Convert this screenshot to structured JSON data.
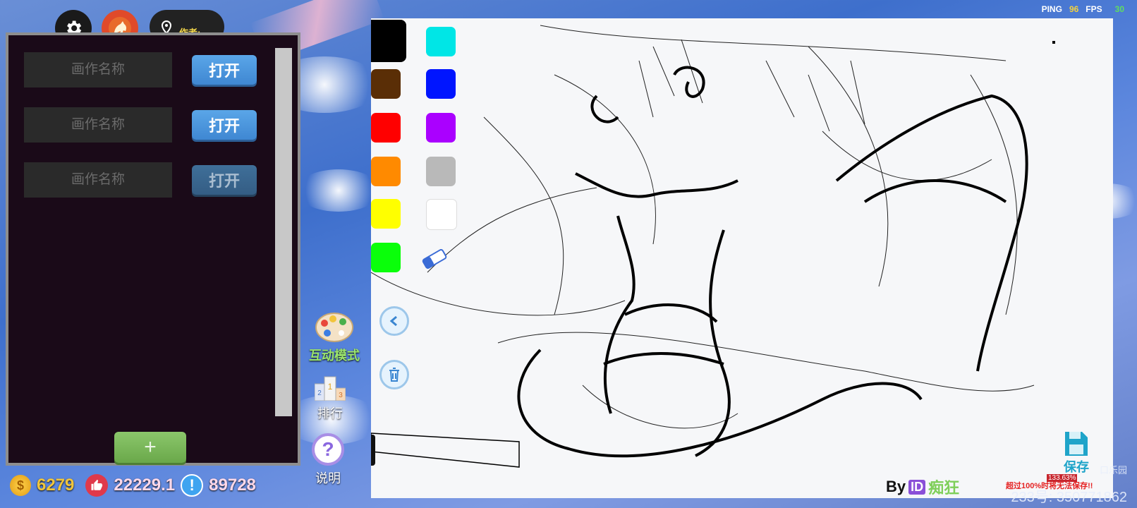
{
  "hud": {
    "ping_label": "PING",
    "ping_value": "96",
    "fps_label": "FPS",
    "fps_value": "30"
  },
  "toolbar": {
    "author_label": "作者:"
  },
  "paintings": [
    {
      "placeholder": "画作名称",
      "open_label": "打开",
      "enabled": true
    },
    {
      "placeholder": "画作名称",
      "open_label": "打开",
      "enabled": true
    },
    {
      "placeholder": "画作名称",
      "open_label": "打开",
      "enabled": false
    }
  ],
  "add_label": "+",
  "stats": {
    "coins": "6279",
    "likes": "22229.1",
    "reports": "89728"
  },
  "side": {
    "interactive_label": "互动模式",
    "rank_label": "排行",
    "help_label": "说明"
  },
  "palette": [
    "#000000",
    "#00e6e6",
    "#5a2e06",
    "#0015ff",
    "#ff0000",
    "#aa00ff",
    "#ff8a00",
    "#b9b9b9",
    "#ffff00",
    "#ffffff",
    "#0aff0a"
  ],
  "canvas": {
    "by_label": "By",
    "id_badge": "ID",
    "author_name": "痴狂",
    "save_label": "保存",
    "percent": "133.63%",
    "warning": "超过100%时将无法保存!!"
  },
  "watermark": {
    "line1": "口乐园",
    "line2": "233号: 350771862"
  }
}
